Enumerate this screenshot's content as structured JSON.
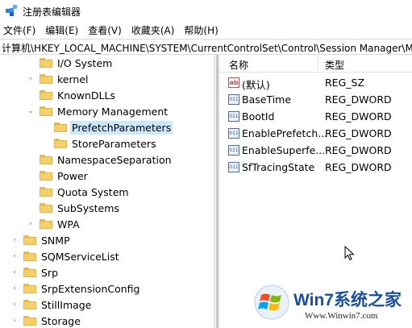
{
  "window": {
    "title": "注册表编辑器"
  },
  "menu": [
    "文件(F)",
    "编辑(E)",
    "查看(V)",
    "收藏夹(A)",
    "帮助(H)"
  ],
  "address": "计算机\\HKEY_LOCAL_MACHINE\\SYSTEM\\CurrentControlSet\\Control\\Session Manager\\Memory Management\\PrefetchParameters",
  "tree": [
    {
      "label": "I/O System",
      "expander": "",
      "depth": 2
    },
    {
      "label": "kernel",
      "expander": "›",
      "depth": 2
    },
    {
      "label": "KnownDLLs",
      "expander": "",
      "depth": 2
    },
    {
      "label": "Memory Management",
      "expander": "⌄",
      "depth": 2
    },
    {
      "label": "PrefetchParameters",
      "expander": "",
      "depth": 3,
      "selected": true
    },
    {
      "label": "StoreParameters",
      "expander": "",
      "depth": 3
    },
    {
      "label": "NamespaceSeparation",
      "expander": "",
      "depth": 2
    },
    {
      "label": "Power",
      "expander": "",
      "depth": 2
    },
    {
      "label": "Quota System",
      "expander": "",
      "depth": 2
    },
    {
      "label": "SubSystems",
      "expander": "",
      "depth": 2
    },
    {
      "label": "WPA",
      "expander": "›",
      "depth": 2
    },
    {
      "label": "SNMP",
      "expander": "›",
      "depth": 1
    },
    {
      "label": "SQMServiceList",
      "expander": "›",
      "depth": 1
    },
    {
      "label": "Srp",
      "expander": "›",
      "depth": 1
    },
    {
      "label": "SrpExtensionConfig",
      "expander": "›",
      "depth": 1
    },
    {
      "label": "StillImage",
      "expander": "›",
      "depth": 1
    },
    {
      "label": "Storage",
      "expander": "›",
      "depth": 1
    }
  ],
  "list": {
    "columns": {
      "name": "名称",
      "type": "类型"
    },
    "rows": [
      {
        "icon": "string-value-icon",
        "name": "(默认)",
        "type": "REG_SZ"
      },
      {
        "icon": "dword-value-icon",
        "name": "BaseTime",
        "type": "REG_DWORD"
      },
      {
        "icon": "dword-value-icon",
        "name": "BootId",
        "type": "REG_DWORD"
      },
      {
        "icon": "dword-value-icon",
        "name": "EnablePrefetch...",
        "type": "REG_DWORD"
      },
      {
        "icon": "dword-value-icon",
        "name": "EnableSuperfe...",
        "type": "REG_DWORD"
      },
      {
        "icon": "dword-value-icon",
        "name": "SfTracingState",
        "type": "REG_DWORD"
      }
    ]
  },
  "watermark": {
    "brand": "Win7系统之家",
    "url": "Www.Winwin7.com"
  },
  "colors": {
    "selection": "#cce8ff",
    "folder": "#f4cf6a",
    "watermark_blue": "#1a4f9e"
  }
}
